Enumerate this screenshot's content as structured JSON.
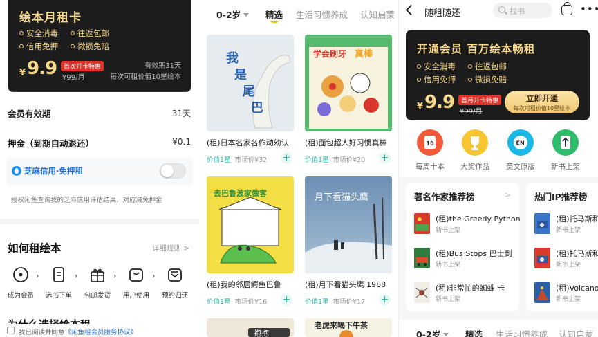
{
  "panel1": {
    "card": {
      "title": "绘本月租卡",
      "bullets": [
        "安全消毒",
        "往返包邮",
        "信用免押",
        "微损免赔"
      ],
      "price_symbol": "¥",
      "price": "9.9",
      "badge": "首次开卡特惠",
      "price_old": "¥99/月",
      "valid": "有效期31天",
      "note": "每次可租价值10星绘本"
    },
    "validity_label": "会员有效期",
    "validity_value": "31天",
    "deposit_label": "押金（到期自动退还）",
    "deposit_value": "¥0.1",
    "zhima_label": "芝麻信用·免押租",
    "zhima_desc": "授权闲鱼查询我的芝麻信用评估结果，对应减免押金",
    "how_title": "如何租绘本",
    "how_more": "详细规则 >",
    "steps": [
      "成为会员",
      "选书下单",
      "包邮发货",
      "用户使用",
      "预约归还"
    ],
    "why_title": "为什么选择绘本租",
    "agree_prefix": "我已阅读并同意",
    "agree_link": "《闲鱼租会员服务协议》"
  },
  "panel2": {
    "age": "0-2岁",
    "tabs": [
      "精选",
      "生活习惯养成",
      "认知启蒙"
    ],
    "books": [
      {
        "title": "(租)日本名家名作动幼认",
        "level": "价值1星",
        "market": "市场价¥32",
        "cover_text": "我是尾巴"
      },
      {
        "title": "(租)面包超人好习惯真棒",
        "level": "价值1星",
        "market": "市场价¥20",
        "cover_text": "学会刷牙真棒"
      },
      {
        "title": "(租)我的邻居鳄鱼巴鲁",
        "level": "价值1星",
        "market": "市场价¥16",
        "cover_text": "去巴鲁波家做客"
      },
      {
        "title": "(租)月下看猫头鹰  1988",
        "level": "价值1星",
        "market": "市场价¥17",
        "cover_text": "月下看猫头鹰"
      },
      {
        "title": "",
        "level": "",
        "market": "",
        "cover_text": "抱抱"
      },
      {
        "title": "",
        "level": "",
        "market": "",
        "cover_text": "老虎来喝下午茶"
      }
    ],
    "plus": "+"
  },
  "panel3": {
    "title": "随租随还",
    "search_placeholder": "找书",
    "more": "•••",
    "card": {
      "title": "开通会员 百万绘本畅租",
      "bullets": [
        "安全消毒",
        "往返包邮",
        "信用免押",
        "微损免赔"
      ],
      "price_symbol": "¥",
      "price": "9.9",
      "badge": "首月开卡特惠",
      "price_old": "¥99/月",
      "button": "立即开通",
      "button_sub": "每次可租价值10星绘本"
    },
    "categories": [
      {
        "label": "每周十本",
        "icon_text": "10",
        "color": "#f25a3a"
      },
      {
        "label": "大奖作品",
        "icon_text": "",
        "color": "#f6c531"
      },
      {
        "label": "英文原版",
        "icon_text": "EN",
        "color": "#1bb7e6"
      },
      {
        "label": "新书上架",
        "icon_text": "",
        "color": "#2fbd6c"
      }
    ],
    "rec1": {
      "title": "著名作家推荐榜",
      "items": [
        {
          "name": "(租)the Greedy Python",
          "sub": "新书上架"
        },
        {
          "name": "(租)Bus Stops  巴士到",
          "sub": "新书上架"
        },
        {
          "name": "(租)非常忙的蜘蛛  卡",
          "sub": "新书上架"
        }
      ]
    },
    "rec2": {
      "title": "热门IP推荐榜",
      "items": [
        {
          "name": "(租)托马斯和",
          "sub": "新书上架"
        },
        {
          "name": "(租)托马斯和",
          "sub": "新书上架"
        },
        {
          "name": "(租)Volcano",
          "sub": "新书上架"
        }
      ]
    },
    "bottom_age": "0-2岁",
    "bottom_tabs": [
      "精选",
      "生活习惯养成",
      "认知启蒙"
    ],
    "arrow": ">"
  },
  "colors": {
    "gold": "#f6d98a",
    "card_bg": "#1c1c1c",
    "teal": "#32b9a6",
    "red_badge": "#e0322a",
    "link_blue": "#1e6fd8"
  }
}
